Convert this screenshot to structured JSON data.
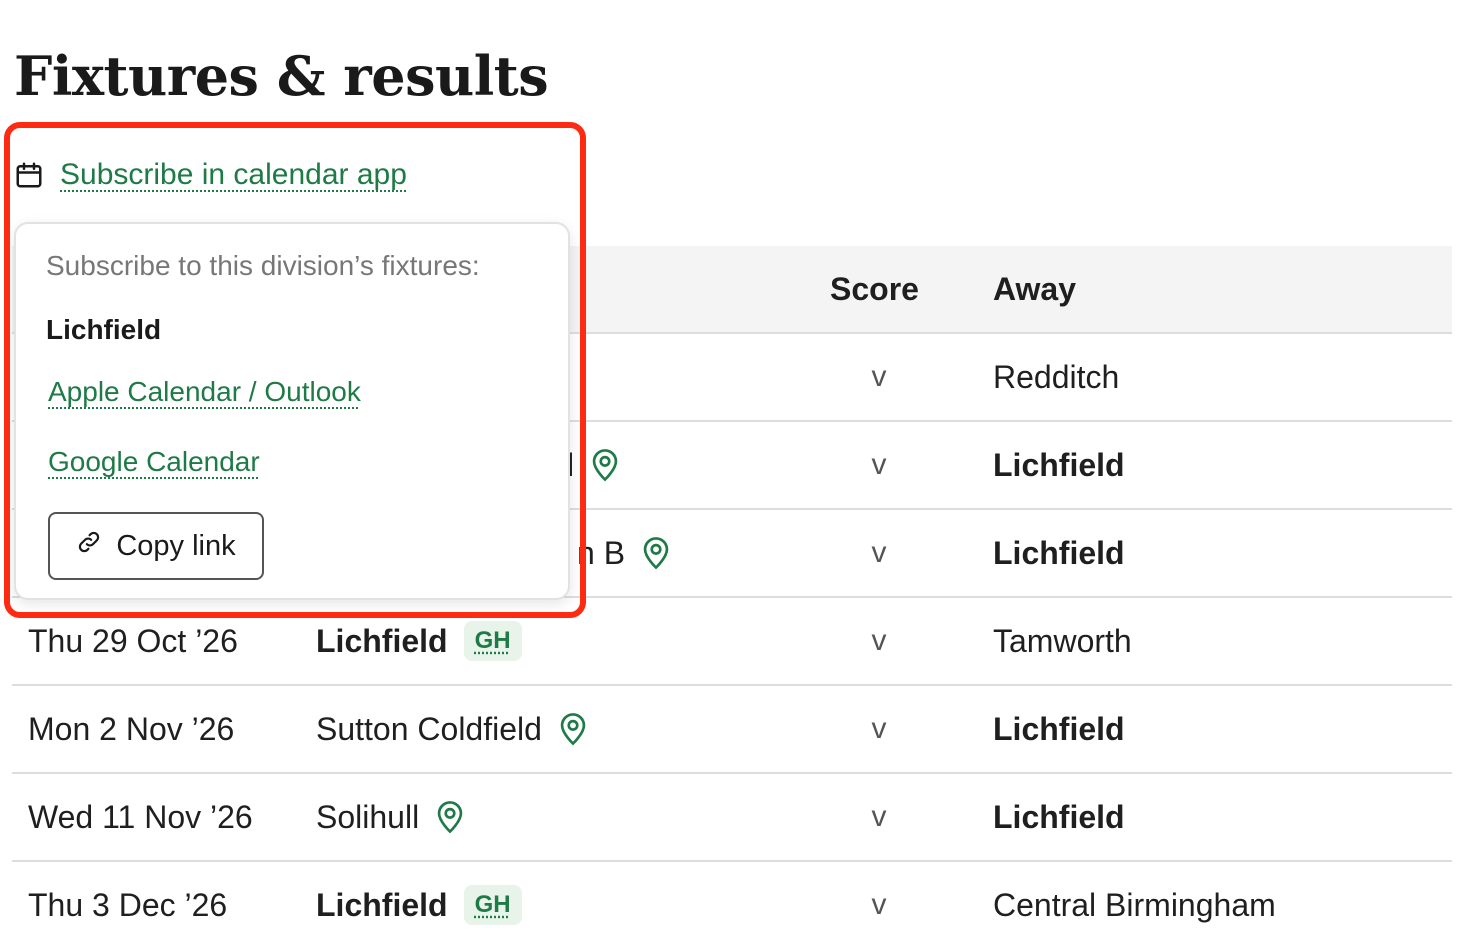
{
  "page": {
    "title": "Fixtures & results"
  },
  "subscribe": {
    "label": "Subscribe in calendar app"
  },
  "popover": {
    "heading": "Subscribe to this division’s fixtures:",
    "team": "Lichfield",
    "apple_label": "Apple Calendar / Outlook",
    "google_label": "Google Calendar",
    "copy_label": "Copy link"
  },
  "table": {
    "columns": {
      "score": "Score",
      "away": "Away"
    },
    "rows": [
      {
        "date": "",
        "home": "",
        "score": "v",
        "away": "Redditch"
      },
      {
        "date": "",
        "home": "l",
        "score": "v",
        "away": "Lichfield"
      },
      {
        "date": "",
        "home": "n B",
        "score": "v",
        "away": "Lichfield"
      },
      {
        "date": "Thu 29 Oct ’26",
        "home": "Lichfield",
        "badge": "GH",
        "score": "v",
        "away": "Tamworth"
      },
      {
        "date": "Mon 2 Nov ’26",
        "home": "Sutton Coldfield",
        "score": "v",
        "away": "Lichfield"
      },
      {
        "date": "Wed 11 Nov ’26",
        "home": "Solihull",
        "score": "v",
        "away": "Lichfield"
      },
      {
        "date": "Thu 3 Dec ’26",
        "home": "Lichfield",
        "badge": "GH",
        "score": "v",
        "away": "Central Birmingham"
      }
    ]
  },
  "colors": {
    "link": "#1e7a46",
    "highlight": "#ff2a12",
    "badge_bg": "#e8f3ea"
  },
  "icons": {
    "subscribe": "calendar-icon",
    "venue": "map-pin-icon",
    "copy": "link-icon"
  }
}
